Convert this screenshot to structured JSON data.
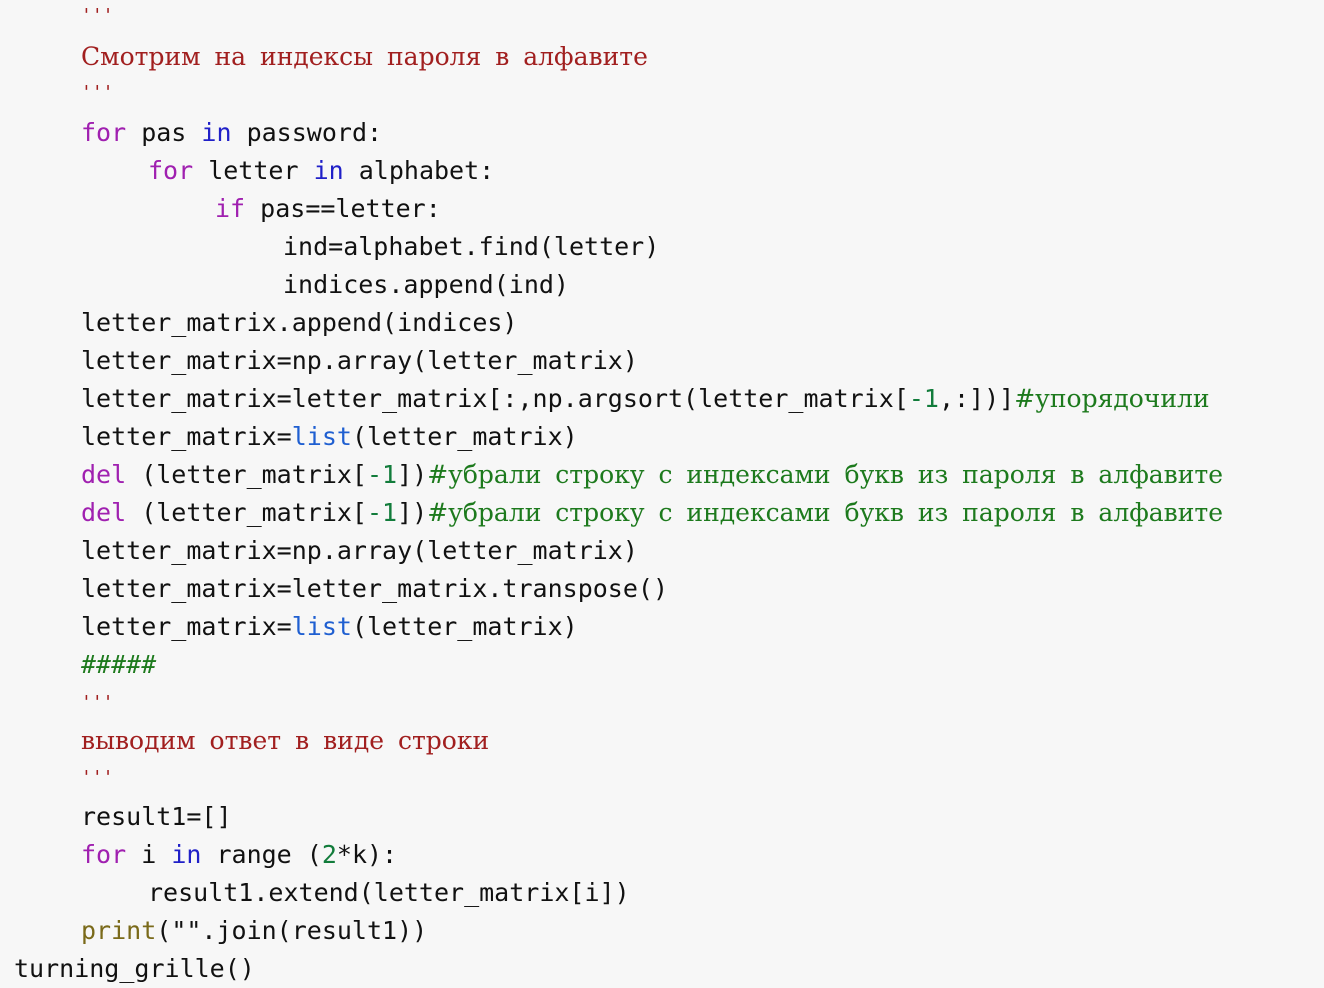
{
  "code": {
    "l1_q": "'''",
    "l2_doc": "Смотрим на индексы пароля в алфавите",
    "l3_q": "'''",
    "l4_kw": "for",
    "l4_a": " pas ",
    "l4_in": "in",
    "l4_b": " password:",
    "l5_kw": "for",
    "l5_a": " letter ",
    "l5_in": "in",
    "l5_b": " alphabet:",
    "l6_kw": "if",
    "l6_a": " pas==letter:",
    "l7": "ind=alphabet.find(letter)",
    "l8": "indices.append(ind)",
    "l9": "letter_matrix.append(indices)",
    "l10": "letter_matrix=np.array(letter_matrix)",
    "l11_a": "letter_matrix=letter_matrix[:,np.argsort(letter_matrix[",
    "l11_num": "-1",
    "l11_b": ",:])]",
    "l11_cm": "#упорядочили",
    "l12_a": "letter_matrix=",
    "l12_bi": "list",
    "l12_b": "(letter_matrix)",
    "l13_kw": "del",
    "l13_a": " (letter_matrix[",
    "l13_num": "-1",
    "l13_b": "])",
    "l13_cm": "#убрали строку с индексами букв из пароля в алфавите",
    "l14_kw": "del",
    "l14_a": " (letter_matrix[",
    "l14_num": "-1",
    "l14_b": "])",
    "l14_cm": "#убрали строку с индексами букв из пароля в алфавите",
    "l15": "letter_matrix=np.array(letter_matrix)",
    "l16": "letter_matrix=letter_matrix.transpose()",
    "l17_a": "letter_matrix=",
    "l17_bi": "list",
    "l17_b": "(letter_matrix)",
    "l18_hash": "#####",
    "l19_q": "'''",
    "l20_doc": "выводим ответ в виде строки",
    "l21_q": "'''",
    "l22": "result1=[]",
    "l23_kw": "for",
    "l23_a": " i ",
    "l23_in": "in",
    "l23_b": " range (",
    "l23_num": "2",
    "l23_c": "*k):",
    "l24": "result1.extend(letter_matrix[i])",
    "l25_fn": "print",
    "l25_a": "(\"\".join(result1))",
    "l26": "turning_grille()"
  },
  "colors": {
    "background": "#f7f7f7",
    "keyword": "#a020b0",
    "in_keyword": "#2020c8",
    "builtin": "#1f5fd1",
    "function": "#7a6a1a",
    "number": "#127c3b",
    "comment": "#1d7a1d",
    "docstring": "#a11f1f"
  }
}
